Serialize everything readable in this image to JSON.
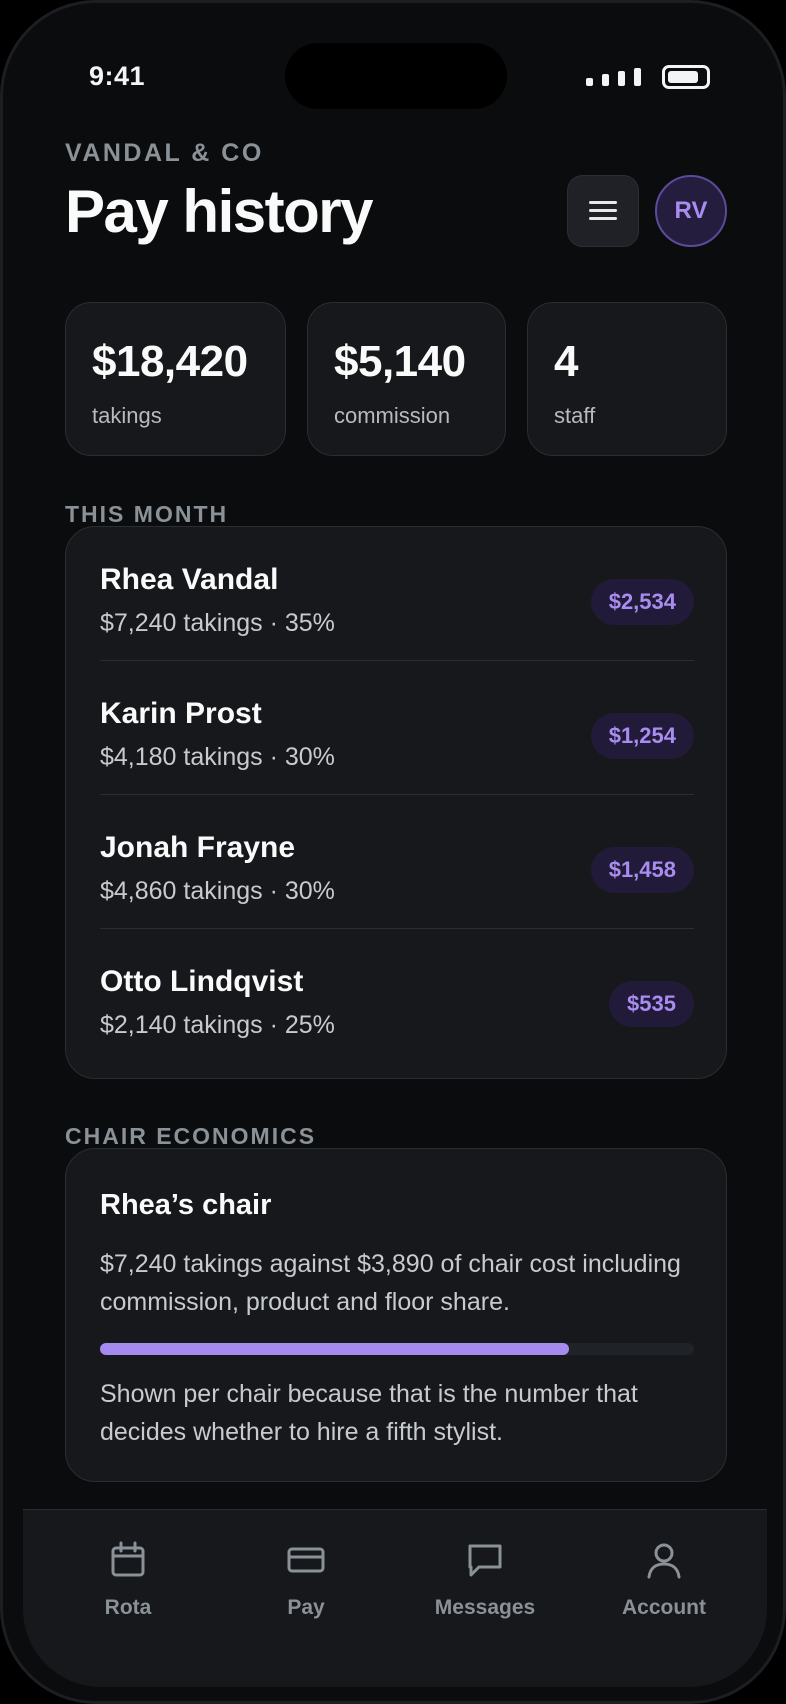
{
  "status_bar": {
    "time": "9:41"
  },
  "header": {
    "brand": "VANDAL & CO",
    "title": "Pay history",
    "avatar_initials": "RV"
  },
  "stats": [
    {
      "value": "$18,420",
      "label": "takings"
    },
    {
      "value": "$5,140",
      "label": "commission"
    },
    {
      "value": "4",
      "label": "staff"
    }
  ],
  "this_month": {
    "label": "THIS MONTH",
    "rows": [
      {
        "name": "Rhea Vandal",
        "detail": "$7,240 takings · 35%",
        "pay": "$2,534"
      },
      {
        "name": "Karin Prost",
        "detail": "$4,180 takings · 30%",
        "pay": "$1,254"
      },
      {
        "name": "Jonah Frayne",
        "detail": "$4,860 takings · 30%",
        "pay": "$1,458"
      },
      {
        "name": "Otto Lindqvist",
        "detail": "$2,140 takings · 25%",
        "pay": "$535"
      }
    ]
  },
  "chair_economics": {
    "label": "CHAIR ECONOMICS",
    "title": "Rhea’s chair",
    "text": "$7,240 takings against $3,890 of chair cost including commission, product and floor share.",
    "progress_fraction": 0.79,
    "note": "Shown per chair because that is the number that decides whether to hire a fifth stylist."
  },
  "tab_bar": {
    "tabs": [
      {
        "label": "Rota",
        "icon": "calendar-icon"
      },
      {
        "label": "Pay",
        "icon": "card-icon"
      },
      {
        "label": "Messages",
        "icon": "message-icon"
      },
      {
        "label": "Account",
        "icon": "person-icon"
      }
    ]
  },
  "colors": {
    "accent": "#a58af0",
    "background": "#0b0c0e",
    "card": "#16181b"
  }
}
